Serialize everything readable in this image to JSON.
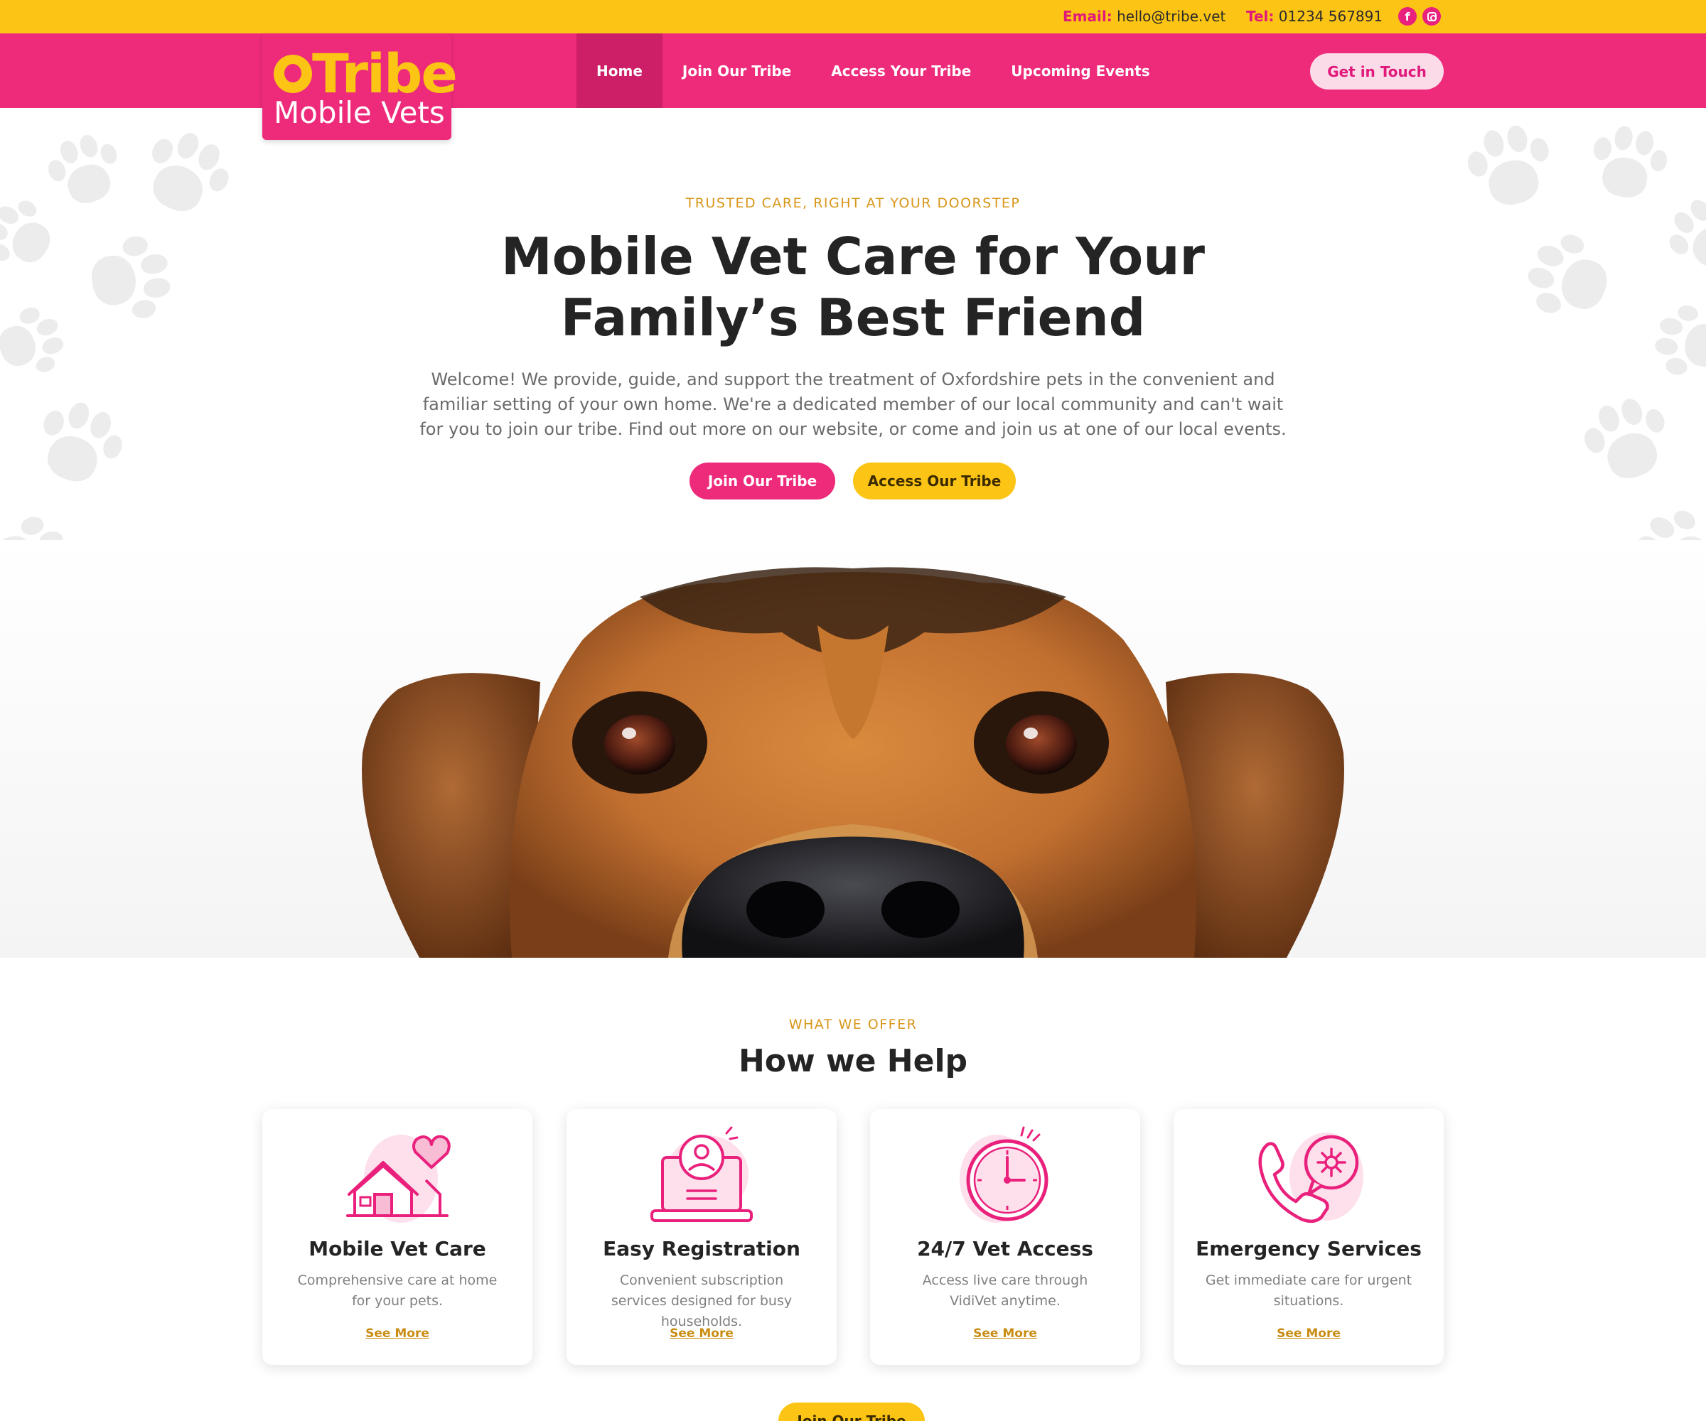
{
  "topbar": {
    "email_label": "Email:",
    "email_value": "hello@tribe.vet",
    "tel_label": "Tel:",
    "tel_value": "01234 567891",
    "facebook_glyph": "f",
    "social_icons": [
      "facebook-icon",
      "instagram-icon"
    ]
  },
  "brand": {
    "name_line1": "Tribe",
    "name_line2": "Mobile Vets",
    "primary_color": "#ee2a7b",
    "accent_color": "#fcc414"
  },
  "nav": {
    "items": [
      {
        "label": "Home",
        "active": true
      },
      {
        "label": "Join Our Tribe",
        "active": false
      },
      {
        "label": "Access Your Tribe",
        "active": false
      },
      {
        "label": "Upcoming Events",
        "active": false
      }
    ],
    "cta_label": "Get in Touch"
  },
  "hero": {
    "eyebrow": "TRUSTED CARE, RIGHT AT YOUR DOORSTEP",
    "title": "Mobile Vet Care for Your Family’s Best Friend",
    "text": "Welcome! We provide, guide, and support the treatment of Oxfordshire pets in the convenient and familiar setting of your own home. We're a dedicated member of our local community and can't wait for you to join our tribe.  Find out more on our website, or come and join us at one of our local events.",
    "primary_button": "Join Our Tribe",
    "secondary_button": "Access Our Tribe"
  },
  "offer": {
    "eyebrow": "WHAT WE OFFER",
    "title": "How we Help",
    "cards": [
      {
        "icon": "house-heart-icon",
        "title": "Mobile Vet Care",
        "text": "Comprehensive care at home for your pets.",
        "link": "See More"
      },
      {
        "icon": "laptop-user-icon",
        "title": "Easy Registration",
        "text": "Convenient subscription services designed for busy households.",
        "link": "See More"
      },
      {
        "icon": "clock-icon",
        "title": "24/7 Vet Access",
        "text": "Access live care through VidiVet anytime.",
        "link": "See More"
      },
      {
        "icon": "phone-emergency-icon",
        "title": "Emergency Services",
        "text": "Get immediate care for urgent situations.",
        "link": "See More"
      }
    ],
    "bottom_button": "Join Our Tribe"
  }
}
